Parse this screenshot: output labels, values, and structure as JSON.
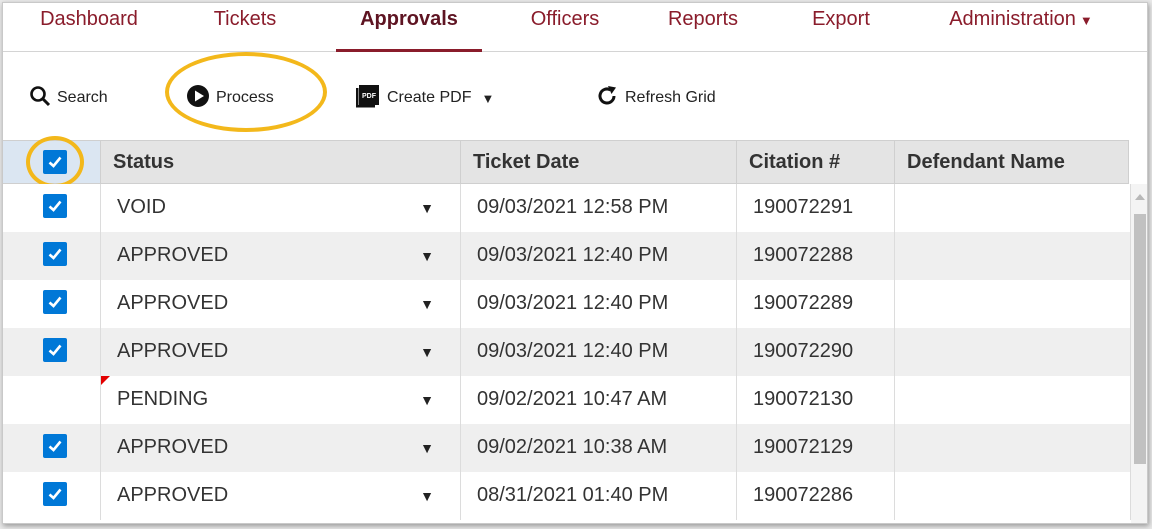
{
  "nav": {
    "items": [
      {
        "label": "Dashboard",
        "active": false
      },
      {
        "label": "Tickets",
        "active": false
      },
      {
        "label": "Approvals",
        "active": true
      },
      {
        "label": "Officers",
        "active": false
      },
      {
        "label": "Reports",
        "active": false
      },
      {
        "label": "Export",
        "active": false
      },
      {
        "label": "Administration",
        "active": false,
        "dropdown": true
      }
    ]
  },
  "toolbar": {
    "search_label": "Search",
    "process_label": "Process",
    "create_pdf_label": "Create PDF",
    "refresh_label": "Refresh Grid"
  },
  "grid": {
    "columns": [
      "Status",
      "Ticket Date",
      "Citation #",
      "Defendant Name"
    ],
    "select_all_checked": true,
    "rows": [
      {
        "checked": true,
        "status": "VOID",
        "ticket_date": "09/03/2021 12:58 PM",
        "citation": "190072291",
        "defendant": "",
        "dirty": false
      },
      {
        "checked": true,
        "status": "APPROVED",
        "ticket_date": "09/03/2021 12:40 PM",
        "citation": "190072288",
        "defendant": "",
        "dirty": false
      },
      {
        "checked": true,
        "status": "APPROVED",
        "ticket_date": "09/03/2021 12:40 PM",
        "citation": "190072289",
        "defendant": "",
        "dirty": false
      },
      {
        "checked": true,
        "status": "APPROVED",
        "ticket_date": "09/03/2021 12:40 PM",
        "citation": "190072290",
        "defendant": "",
        "dirty": false
      },
      {
        "checked": false,
        "status": "PENDING",
        "ticket_date": "09/02/2021 10:47 AM",
        "citation": "190072130",
        "defendant": "",
        "dirty": true
      },
      {
        "checked": true,
        "status": "APPROVED",
        "ticket_date": "09/02/2021 10:38 AM",
        "citation": "190072129",
        "defendant": "",
        "dirty": false
      },
      {
        "checked": true,
        "status": "APPROVED",
        "ticket_date": "08/31/2021 01:40 PM",
        "citation": "190072286",
        "defendant": "",
        "dirty": false
      }
    ]
  },
  "colors": {
    "brand": "#8a1c2b",
    "checkbox": "#0078d7",
    "highlight": "#f3b81b"
  },
  "icons": {
    "search": "search-icon",
    "process": "play-circle-icon",
    "pdf": "pdf-icon",
    "refresh": "refresh-icon",
    "dropdown": "caret-down-icon"
  }
}
